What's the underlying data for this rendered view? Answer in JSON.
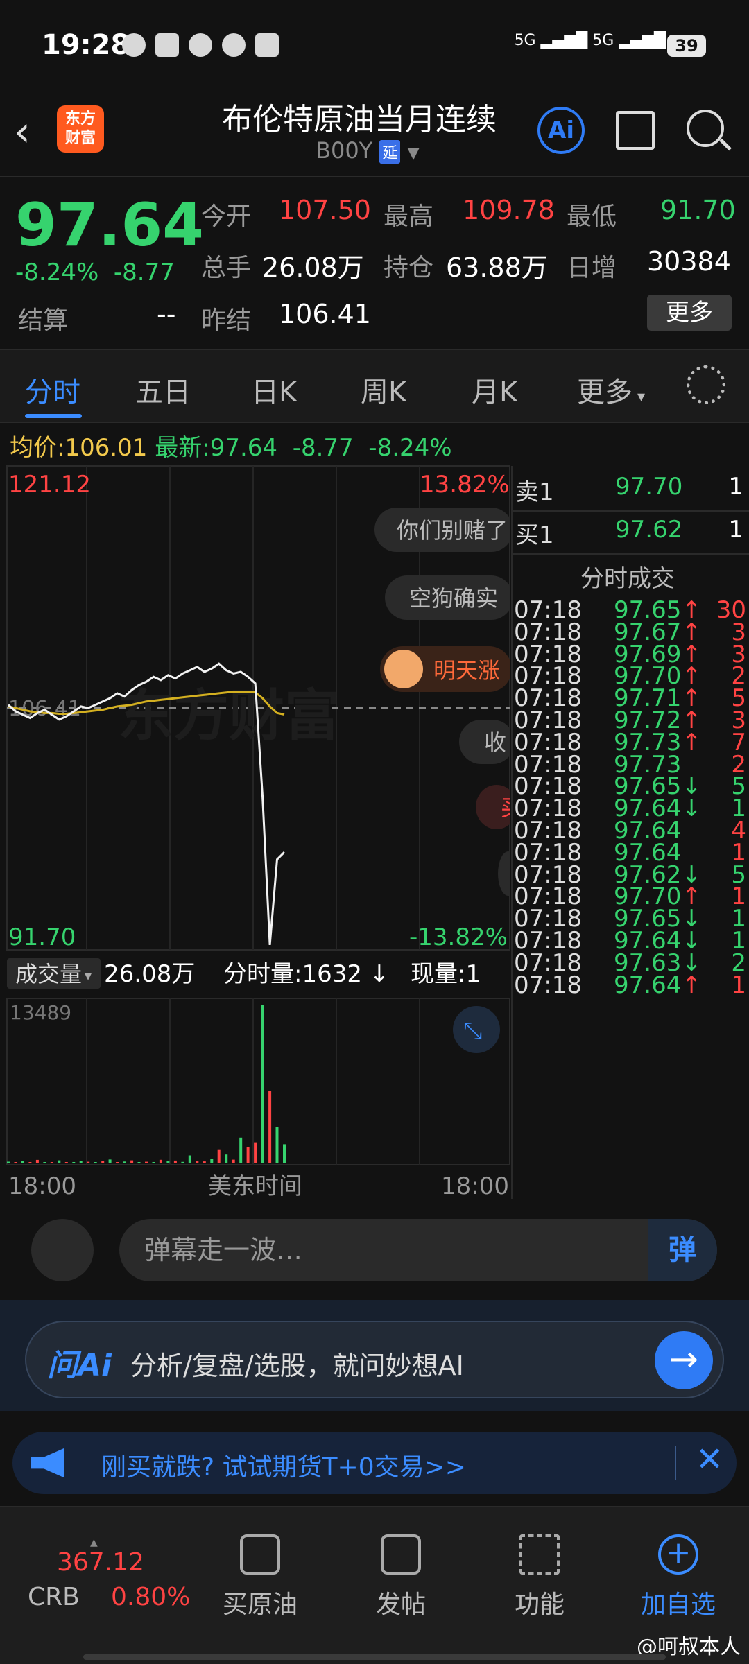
{
  "status": {
    "time": "19:28",
    "signal1": "5G",
    "signal2": "5G",
    "battery": "39"
  },
  "header": {
    "back_icon": "back-arrow-icon",
    "logo": "东方\n财富",
    "title": "布伦特原油当月连续",
    "code": "B00Y",
    "delay_tag": "延"
  },
  "quote": {
    "price": "97.64",
    "change_pct": "-8.24%",
    "change": "-8.77",
    "open_label": "今开",
    "open": "107.50",
    "high_label": "最高",
    "high": "109.78",
    "low_label": "最低",
    "low": "91.70",
    "volume_label": "总手",
    "volume": "26.08万",
    "oi_label": "持仓",
    "oi": "63.88万",
    "day_inc_label": "日增",
    "day_inc": "30384",
    "settle_label": "结算",
    "settle": "--",
    "prev_settle_label": "昨结",
    "prev_settle": "106.41",
    "more": "更多"
  },
  "tabs": [
    "分时",
    "五日",
    "日K",
    "周K",
    "月K",
    "更多"
  ],
  "infoline": {
    "avg_label": "均价:",
    "avg": "106.01",
    "latest_label": "最新:",
    "latest": "97.64",
    "chg": "-8.77",
    "pct": "-8.24%"
  },
  "chart": {
    "top_price": "121.12",
    "top_pct": "13.82%",
    "bottom_price": "91.70",
    "bottom_pct": "-13.82%",
    "ref_price": "106.41",
    "watermark": "东方财富",
    "danmaku": [
      "你们别赌了",
      "空狗确实",
      "明天涨",
      "收",
      "买",
      ""
    ],
    "vol_label": "成交量",
    "vol_total": "26.08万",
    "minute_vol": "分时量:1632 ↓",
    "current": "现量:1",
    "vol_max": "13489",
    "time_start": "18:00",
    "time_mid": "美东时间",
    "time_end": "18:00"
  },
  "chart_data": {
    "type": "line",
    "ylim": [
      91.7,
      121.12
    ],
    "ref": 106.41,
    "price": [
      106.6,
      106.2,
      106.0,
      105.8,
      106.1,
      106.3,
      106.0,
      105.7,
      105.9,
      106.2,
      106.5,
      106.4,
      106.6,
      106.8,
      107.0,
      107.3,
      107.1,
      107.5,
      107.8,
      108.0,
      108.3,
      108.1,
      108.4,
      108.2,
      108.5,
      108.7,
      108.9,
      108.6,
      108.8,
      109.1,
      108.7,
      108.5,
      108.6,
      108.3,
      107.9,
      101.0,
      92.0,
      97.2,
      97.64
    ],
    "avg": [
      106.5,
      106.4,
      106.3,
      106.2,
      106.15,
      106.1,
      106.1,
      106.05,
      106.05,
      106.1,
      106.15,
      106.2,
      106.25,
      106.3,
      106.4,
      106.5,
      106.55,
      106.6,
      106.7,
      106.8,
      106.85,
      106.9,
      106.95,
      107.0,
      107.05,
      107.1,
      107.15,
      107.2,
      107.25,
      107.3,
      107.35,
      107.4,
      107.4,
      107.4,
      107.35,
      107.0,
      106.5,
      106.1,
      106.01
    ],
    "volume": [
      150,
      80,
      220,
      90,
      300,
      120,
      80,
      260,
      110,
      90,
      180,
      140,
      70,
      200,
      330,
      120,
      160,
      260,
      90,
      140,
      110,
      310,
      180,
      240,
      130,
      680,
      210,
      170,
      400,
      1200,
      760,
      320,
      2200,
      1400,
      1800,
      13489,
      6200,
      3100,
      1632
    ],
    "vol_colors": [
      "g",
      "r",
      "g",
      "r",
      "r",
      "g",
      "r",
      "g",
      "r",
      "g",
      "g",
      "r",
      "g",
      "r",
      "g",
      "r",
      "g",
      "r",
      "g",
      "r",
      "g",
      "r",
      "g",
      "r",
      "g",
      "g",
      "r",
      "r",
      "g",
      "r",
      "g",
      "r",
      "g",
      "r",
      "r",
      "g",
      "r",
      "g",
      "g"
    ]
  },
  "book": {
    "ask_label": "卖1",
    "ask_price": "97.70",
    "ask_qty": "1",
    "bid_label": "买1",
    "bid_price": "97.62",
    "bid_qty": "1",
    "ticks_title": "分时成交",
    "ticks": [
      {
        "t": "07:18",
        "p": "97.65",
        "a": "↑",
        "q": "30"
      },
      {
        "t": "07:18",
        "p": "97.67",
        "a": "↑",
        "q": "3"
      },
      {
        "t": "07:18",
        "p": "97.69",
        "a": "↑",
        "q": "3"
      },
      {
        "t": "07:18",
        "p": "97.70",
        "a": "↑",
        "q": "2"
      },
      {
        "t": "07:18",
        "p": "97.71",
        "a": "↑",
        "q": "5"
      },
      {
        "t": "07:18",
        "p": "97.72",
        "a": "↑",
        "q": "3"
      },
      {
        "t": "07:18",
        "p": "97.73",
        "a": "↑",
        "q": "7"
      },
      {
        "t": "07:18",
        "p": "97.73",
        "a": "",
        "q": "2"
      },
      {
        "t": "07:18",
        "p": "97.65",
        "a": "↓",
        "q": "5"
      },
      {
        "t": "07:18",
        "p": "97.64",
        "a": "↓",
        "q": "1"
      },
      {
        "t": "07:18",
        "p": "97.64",
        "a": "",
        "q": "4"
      },
      {
        "t": "07:18",
        "p": "97.64",
        "a": "",
        "q": "1"
      },
      {
        "t": "07:18",
        "p": "97.62",
        "a": "↓",
        "q": "5"
      },
      {
        "t": "07:18",
        "p": "97.70",
        "a": "↑",
        "q": "1"
      },
      {
        "t": "07:18",
        "p": "97.65",
        "a": "↓",
        "q": "1"
      },
      {
        "t": "07:18",
        "p": "97.64",
        "a": "↓",
        "q": "1"
      },
      {
        "t": "07:18",
        "p": "97.63",
        "a": "↓",
        "q": "2"
      },
      {
        "t": "07:18",
        "p": "97.64",
        "a": "↑",
        "q": "1"
      }
    ]
  },
  "danmu": {
    "placeholder": "弹幕走一波…",
    "btn": "弹"
  },
  "ai": {
    "logo": "问Ai",
    "text": "分析/复盘/选股，就问妙想AI",
    "go": "→"
  },
  "promo": {
    "text": "刚买就跌? 试试期货T+0交易>>",
    "close": "✕"
  },
  "bottom": {
    "crb_value": "367.12",
    "crb_name": "CRB",
    "crb_pct": "0.80%",
    "items": [
      "买原油",
      "发帖",
      "功能",
      "加自选"
    ]
  },
  "watermark": "@呵叔本人"
}
